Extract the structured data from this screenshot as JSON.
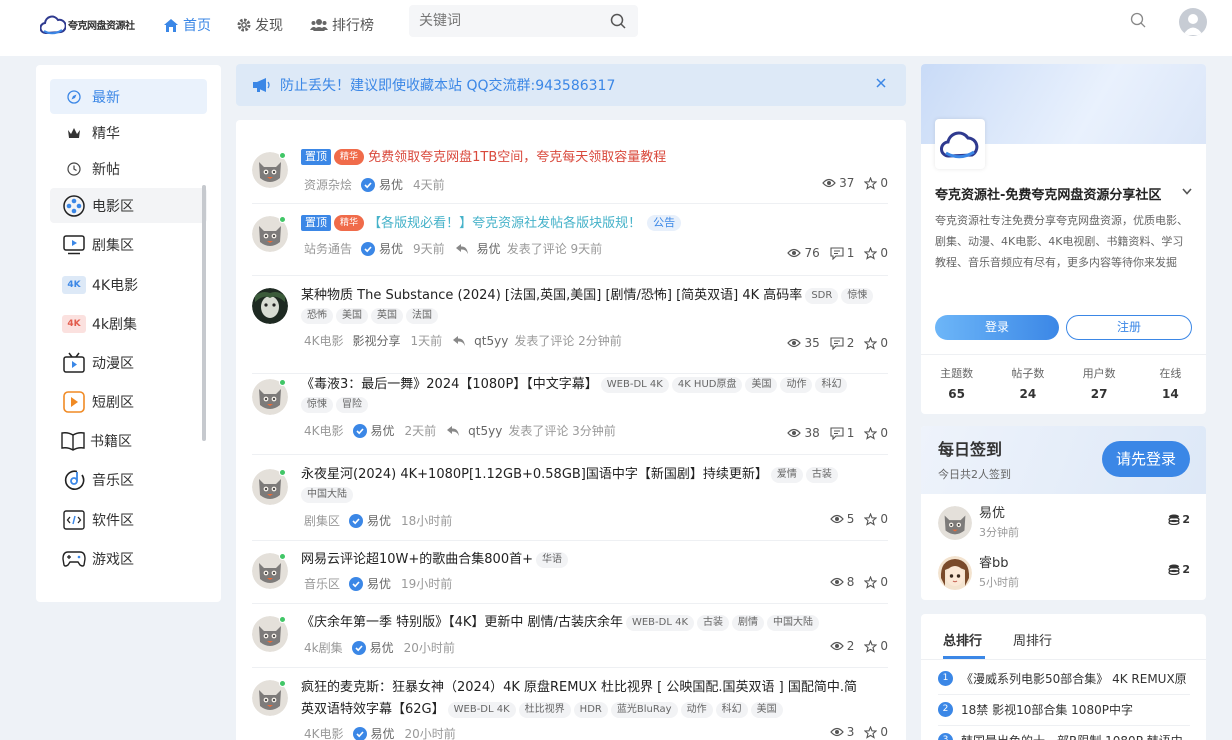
{
  "header": {
    "logo_text": "夸克网盘资源社",
    "nav": [
      {
        "label": "首页"
      },
      {
        "label": "发现"
      },
      {
        "label": "排行榜"
      }
    ],
    "search_placeholder": "关键词"
  },
  "sidebar": {
    "items": [
      {
        "label": "最新"
      },
      {
        "label": "精华"
      },
      {
        "label": "新帖"
      },
      {
        "label": "电影区"
      },
      {
        "label": "剧集区"
      },
      {
        "label": "4K电影",
        "icon_text": "4K"
      },
      {
        "label": "4k剧集",
        "icon_text": "4K"
      },
      {
        "label": "动漫区"
      },
      {
        "label": "短剧区"
      },
      {
        "label": "书籍区"
      },
      {
        "label": "音乐区"
      },
      {
        "label": "软件区"
      },
      {
        "label": "游戏区"
      }
    ]
  },
  "notice": {
    "text": "防止丢失！建议即使收藏本站 QQ交流群:943586317"
  },
  "posts": [
    {
      "pinned": "置顶",
      "essence": "精华",
      "title": "免费领取夸克网盘1TB空间，夸克每天领取容量教程",
      "board": "资源杂烩",
      "author": "易优",
      "time": "4天前",
      "views": "37",
      "likes": "0"
    },
    {
      "pinned": "置顶",
      "essence": "精华",
      "title": "【各版规必看！】夸克资源社发帖各版块版规！",
      "badge": "公告",
      "board": "站务通告",
      "author": "易优",
      "time": "9天前",
      "reply_user": "易优",
      "reply_text": "发表了评论 9天前",
      "views": "76",
      "comments": "1",
      "likes": "0"
    },
    {
      "title": "某种物质 The Substance (2024) [法国,英国,美国] [剧情/恐怖] [简英双语] 4K 高码率",
      "tags": [
        "SDR",
        "惊悚"
      ],
      "tags2": [
        "恐怖",
        "美国",
        "英国",
        "法国"
      ],
      "board": "4K电影",
      "author": "影视分享",
      "time": "1天前",
      "reply_user": "qt5yy",
      "reply_text": "发表了评论 2分钟前",
      "views": "35",
      "comments": "2",
      "likes": "0"
    },
    {
      "title": "《毒液3：最后一舞》2024【1080P】【中文字幕】",
      "tags": [
        "WEB-DL 4K",
        "4K HUD原盘",
        "美国",
        "动作",
        "科幻"
      ],
      "tags2": [
        "惊悚",
        "冒险"
      ],
      "board": "4K电影",
      "author": "易优",
      "time": "2天前",
      "reply_user": "qt5yy",
      "reply_text": "发表了评论 3分钟前",
      "views": "38",
      "comments": "1",
      "likes": "0"
    },
    {
      "title": "永夜星河(2024) 4K+1080P[1.12GB+0.58GB]国语中字【新国剧】持续更新】",
      "tags": [
        "爱情",
        "古装"
      ],
      "tags2": [
        "中国大陆"
      ],
      "board": "剧集区",
      "author": "易优",
      "time": "18小时前",
      "views": "5",
      "likes": "0"
    },
    {
      "title": "网易云评论超10W+的歌曲合集800首+",
      "tags": [
        "华语"
      ],
      "board": "音乐区",
      "author": "易优",
      "time": "19小时前",
      "views": "8",
      "likes": "0"
    },
    {
      "title": "《庆余年第一季 特别版》【4K】更新中 剧情/古装庆余年",
      "tags": [
        "WEB-DL 4K",
        "古装",
        "剧情",
        "中国大陆"
      ],
      "board": "4k剧集",
      "author": "易优",
      "time": "20小时前",
      "views": "2",
      "likes": "0"
    },
    {
      "title": "疯狂的麦克斯：狂暴女神（2024）4K 原盘REMUX 杜比视界 [ 公映国配.国英双语 ] 国配简中.简",
      "title2": "英双语特效字幕【62G】",
      "tags": [
        "WEB-DL 4K",
        "杜比视界",
        "HDR",
        "蓝光BluRay",
        "动作",
        "科幻",
        "美国"
      ],
      "board": "4K电影",
      "author": "易优",
      "time": "20小时前",
      "views": "3",
      "likes": "0"
    }
  ],
  "profile": {
    "name": "夸克资源社-免费夸克网盘资源分享社区",
    "desc": "夸克资源社专注免费分享夸克网盘资源，优质电影、剧集、动漫、4K电影、4K电视剧、书籍资料、学习教程、音乐音频应有尽有，更多内容等待你来发掘",
    "login": "登录",
    "register": "注册",
    "stats": [
      {
        "label": "主题数",
        "value": "65"
      },
      {
        "label": "帖子数",
        "value": "24"
      },
      {
        "label": "用户数",
        "value": "27"
      },
      {
        "label": "在线",
        "value": "14"
      }
    ]
  },
  "signin": {
    "title": "每日签到",
    "subtitle": "今日共2人签到",
    "button": "请先登录",
    "users": [
      {
        "name": "易优",
        "time": "3分钟前",
        "coins": "2"
      },
      {
        "name": "睿bb",
        "time": "5小时前",
        "coins": "2"
      }
    ]
  },
  "ranking": {
    "tabs": [
      "总排行",
      "周排行"
    ],
    "items": [
      {
        "num": "1",
        "text": "《漫威系列电影50部合集》 4K REMUX原"
      },
      {
        "num": "2",
        "text": "18禁 影视10部合集 1080P中字"
      },
      {
        "num": "3",
        "text": "韩国最出色的十一部R限制 1080P 韩语中"
      }
    ]
  },
  "colors": {
    "accent": "#3b87e6",
    "essence": "#f06b4a",
    "online": "#41c667",
    "pinned_title": "#d9483b",
    "notice_bg": "#dde9f7"
  }
}
